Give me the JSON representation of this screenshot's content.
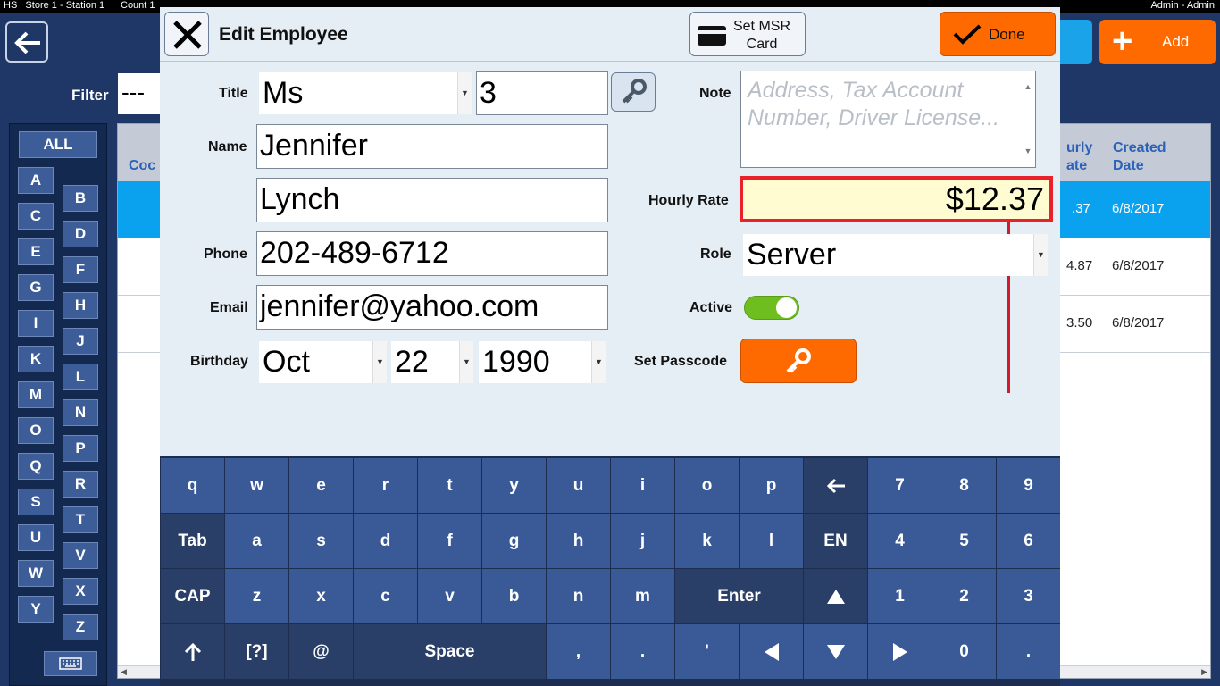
{
  "topbar": {
    "left": "HS   Store 1 - Station 1",
    "center": "Count 1",
    "right": "Admin - Admin"
  },
  "header": {
    "add_label": "Add"
  },
  "filter": {
    "label": "Filter",
    "value": "---"
  },
  "alpha": {
    "all": "ALL",
    "left": [
      "A",
      "C",
      "E",
      "G",
      "I",
      "K",
      "M",
      "O",
      "Q",
      "S",
      "U",
      "W",
      "Y"
    ],
    "right": [
      "B",
      "D",
      "F",
      "H",
      "J",
      "L",
      "N",
      "P",
      "R",
      "T",
      "V",
      "X",
      "Z"
    ]
  },
  "table": {
    "col_code": "Coc",
    "col_hourly": "urly\nate",
    "col_created": "Created\nDate",
    "rows": [
      {
        "rate": ".37",
        "created": "6/8/2017"
      },
      {
        "rate": "4.87",
        "created": "6/8/2017"
      },
      {
        "rate": "3.50",
        "created": "6/8/2017"
      }
    ]
  },
  "modal": {
    "title": "Edit Employee",
    "msr_label_1": "Set MSR",
    "msr_label_2": "Card",
    "done_label": "Done",
    "labels": {
      "title": "Title",
      "name": "Name",
      "phone": "Phone",
      "email": "Email",
      "birthday": "Birthday",
      "note": "Note",
      "hourly_rate": "Hourly Rate",
      "role": "Role",
      "active": "Active",
      "set_passcode": "Set Passcode"
    },
    "values": {
      "title": "Ms",
      "number": "3",
      "first_name": "Jennifer",
      "last_name": "Lynch",
      "phone": "202-489-6712",
      "email": "jennifer@yahoo.com",
      "birth_month": "Oct",
      "birth_day": "22",
      "birth_year": "1990",
      "hourly_rate": "$12.37",
      "role": "Server",
      "active": true
    },
    "note_placeholder": "Address, Tax Account Number, Driver License..."
  },
  "keyboard": {
    "row1": [
      "q",
      "w",
      "e",
      "r",
      "t",
      "y",
      "u",
      "i",
      "o",
      "p"
    ],
    "row2": [
      "Tab",
      "a",
      "s",
      "d",
      "f",
      "g",
      "h",
      "j",
      "k",
      "l",
      "EN"
    ],
    "row3": [
      "CAP",
      "z",
      "x",
      "c",
      "v",
      "b",
      "n",
      "m"
    ],
    "enter": "Enter",
    "row4_misc": [
      "[?]",
      "@"
    ],
    "space": "Space",
    "comma": ",",
    "dot1": ".",
    "apos": "'",
    "numpad": [
      "7",
      "8",
      "9",
      "4",
      "5",
      "6",
      "1",
      "2",
      "3",
      "0",
      "."
    ]
  },
  "colors": {
    "accent": "#ff6a00",
    "selected_row": "#0aa1ef",
    "key": "#3a5a97",
    "highlight_border": "#e8212b"
  }
}
